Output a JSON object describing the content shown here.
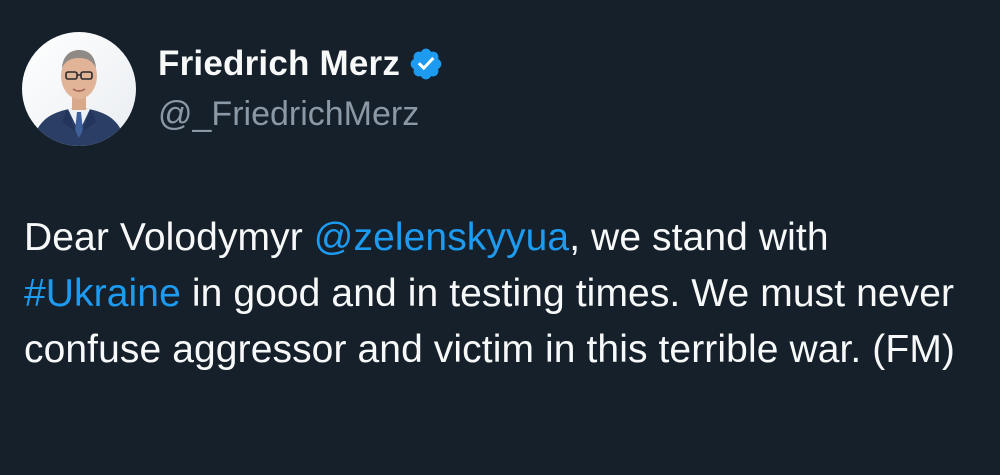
{
  "author": {
    "display_name": "Friedrich Merz",
    "handle": "@_FriedrichMerz",
    "verified": true
  },
  "tweet": {
    "segments": [
      {
        "text": "Dear Volodymyr ",
        "type": "text"
      },
      {
        "text": "@zelenskyyua",
        "type": "mention"
      },
      {
        "text": ", we stand with ",
        "type": "text"
      },
      {
        "text": "#Ukraine",
        "type": "hashtag"
      },
      {
        "text": " in good and in testing times. We must never confuse aggressor and victim in this terrible war. (FM)",
        "type": "text"
      }
    ]
  },
  "colors": {
    "background": "#15202b",
    "text": "#f7f9f9",
    "secondary_text": "#8b98a5",
    "link": "#1d9bf0",
    "verified_badge": "#1d9bf0"
  },
  "icons": {
    "verified": "verified-badge-icon",
    "avatar": "profile-photo"
  }
}
